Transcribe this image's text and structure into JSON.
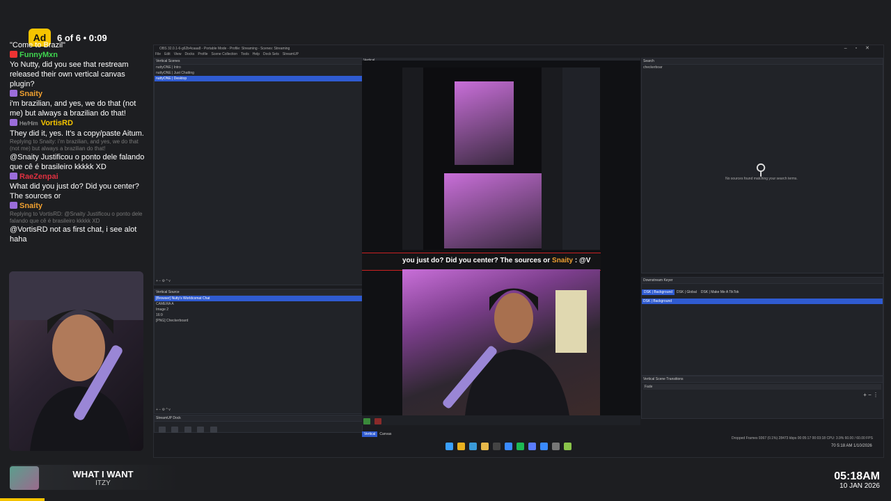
{
  "ad": {
    "badge": "Ad",
    "progress": "6 of 6 • 0:09"
  },
  "chat": {
    "top_fragment": "\"Come to Brazil\"",
    "messages": [
      {
        "user": "FunnyMxn",
        "color": "#3fd64f",
        "badge_color": "#e33",
        "text": "Yo Nutty, did you see that restream released their own vertical canvas plugin?"
      },
      {
        "user": "Snaity",
        "color": "#f0a030",
        "badge_color": "#9b6ddb",
        "text": "i'm brazilian, and yes, we do that (not me) but always a brazilian do that!"
      },
      {
        "user": "VortisRD",
        "color": "#f5c400",
        "badge_color": "#9b6ddb",
        "pronoun": "He/Him",
        "text": "They did it, yes. It's a copy/paste Aitum."
      },
      {
        "reply": "Replying to Snaity: i'm brazilian, and yes, we do that (not me) but always a brazilian do that!",
        "text": "@Snaity Justificou o ponto dele falando que cê é brasileiro kkkkk XD"
      },
      {
        "user": "RaeZenpai",
        "color": "#e03040",
        "badge_color": "#9b6ddb",
        "text": "What did you just do? Did you center? The sources or"
      },
      {
        "user": "Snaity",
        "color": "#f0a030",
        "badge_color": "#9b6ddb",
        "reply": "Replying to VortisRD: @Snaity Justificou o ponto dele falando que cê é brasileiro kkkkk XD",
        "text": "@VortisRD not as first chat, i see alot haha"
      }
    ]
  },
  "song": {
    "title": "WHAT I WANT",
    "artist": "ITZY"
  },
  "clock": {
    "time": "05:18AM",
    "date": "10 JAN 2026"
  },
  "obs": {
    "title": "OBS 32.0.1-6-g62b4caaa8 - Portable Mode - Profile: Streaming - Scenes: Streaming",
    "menu": [
      "File",
      "Edit",
      "View",
      "Docks",
      "Profile",
      "Scene Collection",
      "Tools",
      "Help",
      "Dock Sets",
      "StreamUP"
    ],
    "scenes_title": "Vertical Scenes",
    "scenes": [
      "nuttyONE | Intro",
      "nuttyONE | Just Chatting",
      "nuttyONE | Desktop"
    ],
    "preview_title": "Vertical",
    "sources_title": "Vertical Source",
    "sources": [
      "[Browser] Nutty's Worldcomat Chat",
      "CAMERA A",
      "Image 2",
      "16:9",
      "[PNG] Checkerboard"
    ],
    "streamup_title": "StreamUP Dock",
    "search_title": "Search",
    "search_value": "checkerboar",
    "no_sources": "No sources found matching your search terms.",
    "dsk_title": "Downstream Keyer",
    "dsk_tabs": [
      "DSK | Background",
      "DSK | Global",
      "DSK | Make Me A TikTok"
    ],
    "dsk_item": "DSK | Background",
    "transitions_title": "Vertical Scene Transitions",
    "transition_value": "Fade",
    "bottom_tabs": [
      "Vertical",
      "Canvas"
    ],
    "status": "Dropped Frames 9367 (0.1%)    28473 kbps    00:05:17    00:03:18  CPU: 3.9%  60.00 / 60.00 FPS",
    "chat_strip": {
      "text": "you just do? Did you center? The sources or",
      "user": "Snaity",
      "tail": ": @V"
    }
  },
  "taskbar": {
    "icons": [
      "windows-icon",
      "chrome-icon",
      "edge-icon",
      "folder-icon",
      "obs-icon",
      "app-icon",
      "spotify-icon",
      "app-icon",
      "app-icon",
      "app-icon",
      "app-icon"
    ],
    "tray_time": "5:18 AM",
    "tray_date": "1/10/2026",
    "tray_temp": "70"
  }
}
